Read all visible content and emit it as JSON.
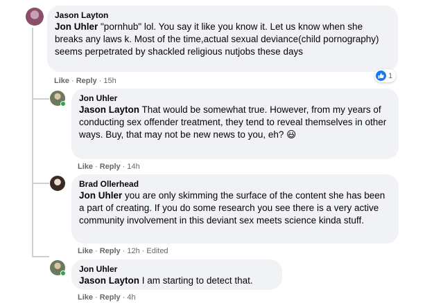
{
  "comments": [
    {
      "author": "Jason Layton",
      "tag": "Jon Uhler",
      "text": " \"pornhub\" lol. You say it like you know it. Let us know when she breaks any laws k. Most of the time,actual sexual deviance(child pornography) seems perpetrated by shackled religious nutjobs these days",
      "actions": {
        "like": "Like",
        "reply": "Reply",
        "time": "15h"
      },
      "reaction_count": "1",
      "reaction_icon": "like-icon",
      "avatar_color": "#8a4f6b"
    },
    {
      "author": "Jon Uhler",
      "tag": "Jason Layton",
      "text": " That would be somewhat true. However, from my years of conducting sex offender treatment, they tend to reveal themselves in other ways. Buy, that may not be new news to you, eh? ",
      "emoji": "😃",
      "actions": {
        "like": "Like",
        "reply": "Reply",
        "time": "14h"
      },
      "avatar_color": "#6b7a5a"
    },
    {
      "author": "Brad Ollerhead",
      "tag": "Jon Uhler",
      "text": " you are only skimming the surface of the content she has been a part of creating. If you do some research you see there is a very active community involvement in this deviant sex meets science kinda stuff.",
      "actions": {
        "like": "Like",
        "reply": "Reply",
        "time": "12h",
        "edited": "Edited"
      },
      "avatar_color": "#3a2a22"
    },
    {
      "author": "Jon Uhler",
      "tag": "Jason Layton",
      "text": " I am starting to detect that.",
      "actions": {
        "like": "Like",
        "reply": "Reply",
        "time": "4h"
      },
      "avatar_color": "#6b7a5a"
    }
  ],
  "colors": {
    "bubble": "#f0f2f5",
    "meta_text": "#65676b",
    "like_blue": "#1877f2",
    "online_green": "#31a24c"
  }
}
